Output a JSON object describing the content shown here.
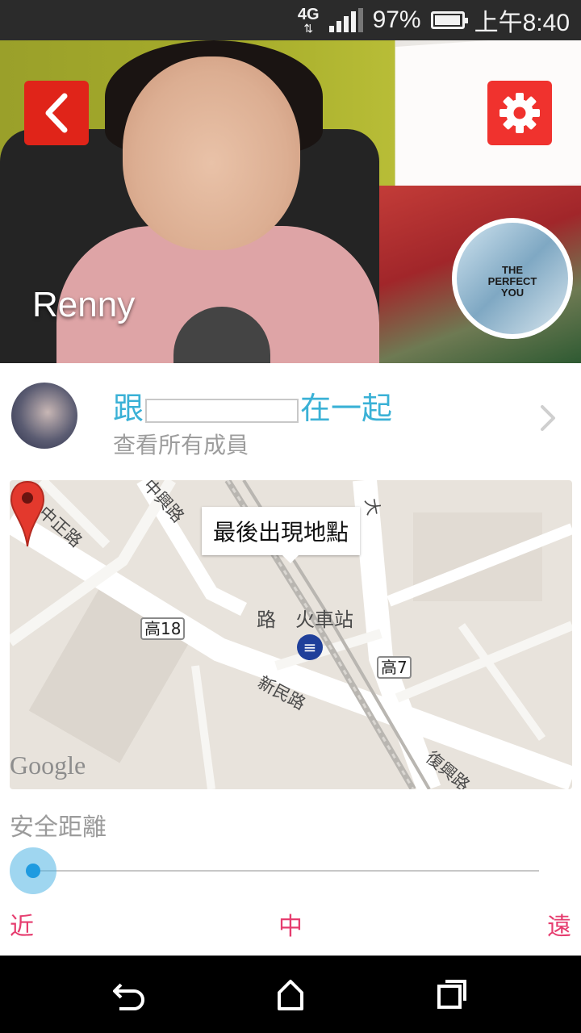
{
  "status_bar": {
    "network": "4G",
    "battery_percent": "97%",
    "time": "上午8:40",
    "signal_bars": 4
  },
  "hero": {
    "name": "Renny",
    "album_text_line1": "THE",
    "album_text_line2": "PERFECT",
    "album_text_line3": "YOU",
    "accent_color": "#e8231b"
  },
  "member": {
    "title_prefix": "跟",
    "title_suffix": "在一起",
    "subtitle": "查看所有成員"
  },
  "map": {
    "callout": "最後出現地點",
    "station": "路竹火車站",
    "station_visible": "路",
    "station_rest": "火車站",
    "roads": {
      "zhongzheng": "中正路",
      "zhongxing": "中興路",
      "xinmin": "新民路",
      "fuxing": "復興路",
      "da": "大"
    },
    "shields": {
      "gao18": "高18",
      "gao7": "高7"
    },
    "attribution": "Google"
  },
  "safety": {
    "label": "安全距離",
    "near": "近",
    "mid": "中",
    "far": "遠",
    "level": 0
  }
}
